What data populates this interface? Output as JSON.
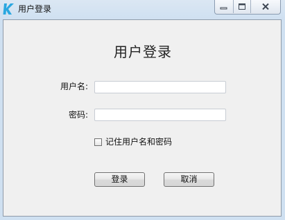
{
  "window": {
    "title": "用户登录",
    "app_icon": "k-logo-icon",
    "controls": [
      "minimize-icon",
      "maximize-icon",
      "close-icon"
    ]
  },
  "form": {
    "heading": "用户登录",
    "username": {
      "label": "用户名:",
      "value": ""
    },
    "password": {
      "label": "密码:",
      "value": ""
    },
    "remember": {
      "label": "记住用户名和密码",
      "checked": false
    },
    "login_button": "登录",
    "cancel_button": "取消"
  },
  "colors": {
    "logo": "#2aa7e0",
    "dialog_background": "#f0f0f0"
  }
}
